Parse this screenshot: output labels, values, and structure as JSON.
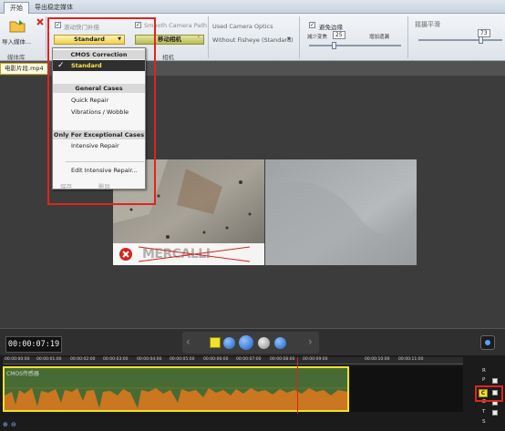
{
  "tabs": {
    "start": "开始",
    "export": "导出稳定媒体"
  },
  "ribbon": {
    "import_label": "导入媒体...",
    "media_library_label": "媒体库",
    "rolling_shutter_label": "滚动快门补偿",
    "rolling_shutter_checked": true,
    "correction_value": "Standard",
    "smooth_camera_label": "Smooth Camera Path",
    "smooth_camera_checked": true,
    "camera_mode_value": "移动相机",
    "camera_group_label": "相机",
    "used_optics_label": "Used Camera Optics",
    "optics_value": "Without Fisheye (Standard)",
    "avoid_borders_label": "避免边缘",
    "avoid_borders_checked": true,
    "min_zoom_label": "减少变焦",
    "max_zoom_label": "增加遗漏",
    "zoom_value": "25",
    "smooth_label": "摇摄平滑",
    "smooth_value": "73"
  },
  "document_tab": "电影片段.mp4",
  "dropdown_menu": {
    "header_cmos": "CMOS Correction",
    "item_standard": "Standard",
    "header_general": "General Cases",
    "item_quick": "Quick Repair",
    "item_vibrations": "Vibrations / Wobble",
    "header_exceptional": "Only For Exceptional Cases",
    "item_intensive": "Intensive Repair",
    "item_edit": "Edit Intensive Repair...",
    "footer_save": "保存",
    "footer_delete": "删除"
  },
  "watermark_text": "MERCALLI",
  "playback": {
    "timecode": "00:00:07:19"
  },
  "timeline": {
    "track_label": "CMOS传感器",
    "ruler_ticks": [
      "00:00:00:00",
      "00:00:01:00",
      "00:00:02:00",
      "00:00:03:00",
      "00:00:04:00",
      "00:00:05:00",
      "00:00:06:00",
      "00:00:07:00",
      "00:00:08:00",
      "00:00:09:00",
      "00:00:10:00",
      "00:00:11:00"
    ],
    "legend": [
      "R",
      "P",
      "C",
      "Z",
      "T",
      "S"
    ],
    "selected_legend": "C"
  },
  "colors": {
    "accent_yellow": "#f0e22b",
    "highlight_red": "#e1241d",
    "waveform_orange": "#e07a1f"
  },
  "icons": [
    "folder-import-icon",
    "delete-x-icon",
    "checkmark-icon",
    "play-icon",
    "pause-icon",
    "rewind-icon",
    "forward-icon",
    "frame-icon",
    "zoom-in-icon",
    "zoom-out-icon"
  ]
}
